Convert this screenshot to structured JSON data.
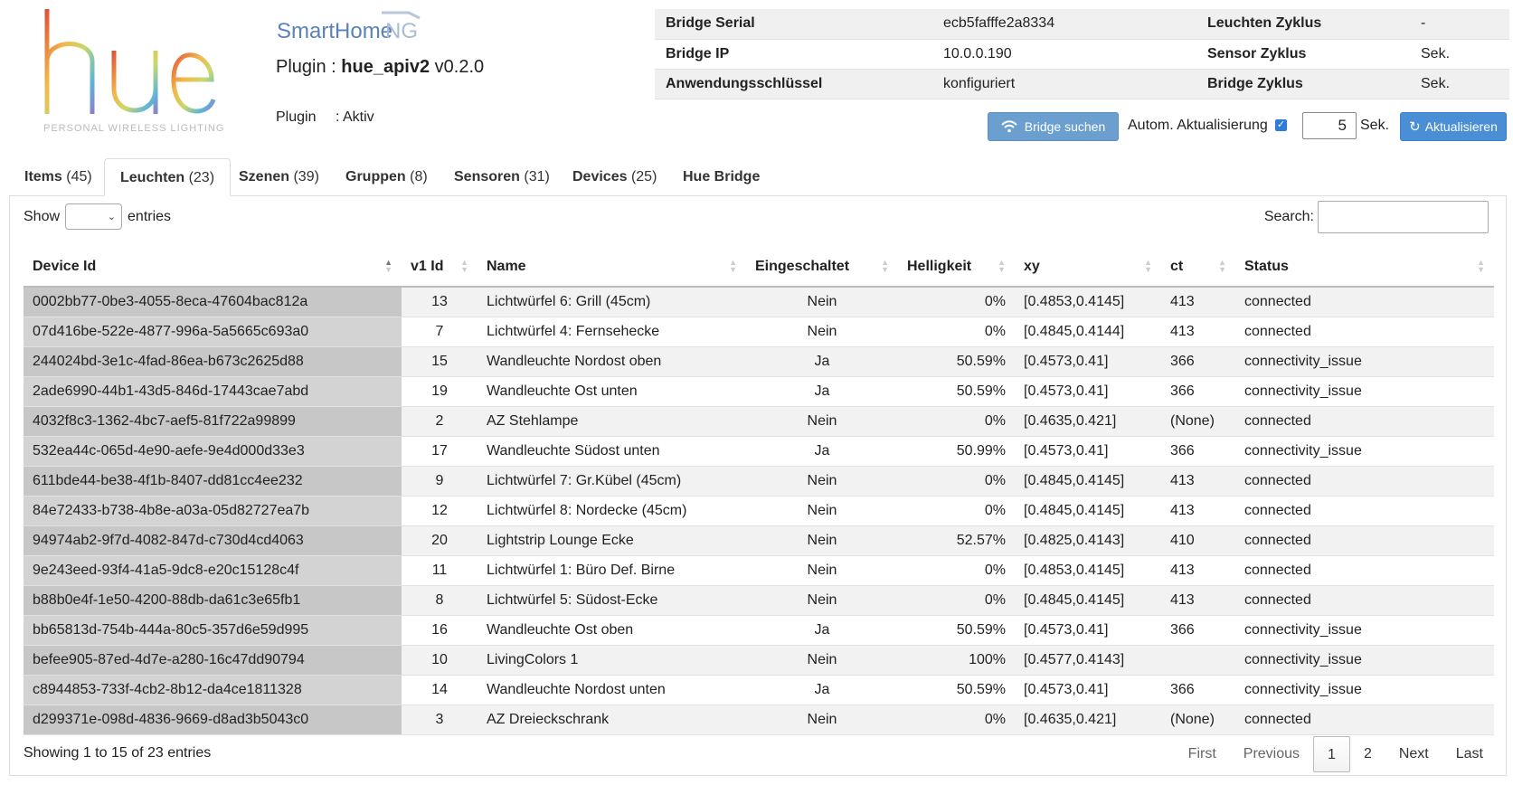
{
  "logo": {
    "name": "hue",
    "tagline": "PERSONAL WIRELESS LIGHTING"
  },
  "smarthome_logo": "SmartHomeNG",
  "plugin": {
    "title_prefix": "Plugin : ",
    "name": "hue_apiv2",
    "version": "v0.2.0",
    "status_label": "Plugin",
    "status_value": ": Aktiv"
  },
  "bridge_info": [
    {
      "k1": "Bridge Serial",
      "v1": "ecb5fafffe2a8334",
      "k2": "Leuchten Zyklus",
      "v2": "-"
    },
    {
      "k1": "Bridge IP",
      "v1": "10.0.0.190",
      "k2": "Sensor Zyklus",
      "v2": "Sek."
    },
    {
      "k1": "Anwendungsschlüssel",
      "v1": "konfiguriert",
      "k2": "Bridge Zyklus",
      "v2": "Sek."
    }
  ],
  "controls": {
    "bridge_search_label": "Bridge suchen",
    "auto_update_label": "Autom. Aktualisierung",
    "auto_update_checked": true,
    "interval_value": "5",
    "interval_unit": "Sek.",
    "refresh_label": "Aktualisieren",
    "accent": "#4a8fd6"
  },
  "tabs": [
    {
      "label": "Items",
      "count": "(45)",
      "active": false
    },
    {
      "label": "Leuchten",
      "count": "(23)",
      "active": true
    },
    {
      "label": "Szenen",
      "count": "(39)",
      "active": false
    },
    {
      "label": "Gruppen",
      "count": "(8)",
      "active": false
    },
    {
      "label": "Sensoren",
      "count": "(31)",
      "active": false
    },
    {
      "label": "Devices",
      "count": "(25)",
      "active": false
    },
    {
      "label": "Hue Bridge",
      "count": "",
      "active": false
    }
  ],
  "table_controls": {
    "show_label": "Show",
    "entries_label": "entries",
    "search_label": "Search:",
    "search_value": ""
  },
  "columns": [
    "Device Id",
    "v1 Id",
    "Name",
    "Eingeschaltet",
    "Helligkeit",
    "xy",
    "ct",
    "Status"
  ],
  "rows": [
    [
      "0002bb77-0be3-4055-8eca-47604bac812a",
      "13",
      "Lichtwürfel 6: Grill (45cm)",
      "Nein",
      "0%",
      "[0.4853,0.4145]",
      "413",
      "connected"
    ],
    [
      "07d416be-522e-4877-996a-5a5665c693a0",
      "7",
      "Lichtwürfel 4: Fernsehecke",
      "Nein",
      "0%",
      "[0.4845,0.4144]",
      "413",
      "connected"
    ],
    [
      "244024bd-3e1c-4fad-86ea-b673c2625d88",
      "15",
      "Wandleuchte Nordost oben",
      "Ja",
      "50.59%",
      "[0.4573,0.41]",
      "366",
      "connectivity_issue"
    ],
    [
      "2ade6990-44b1-43d5-846d-17443cae7abd",
      "19",
      "Wandleuchte Ost unten",
      "Ja",
      "50.59%",
      "[0.4573,0.41]",
      "366",
      "connectivity_issue"
    ],
    [
      "4032f8c3-1362-4bc7-aef5-81f722a99899",
      "2",
      "AZ Stehlampe",
      "Nein",
      "0%",
      "[0.4635,0.421]",
      "(None)",
      "connected"
    ],
    [
      "532ea44c-065d-4e90-aefe-9e4d000d33e3",
      "17",
      "Wandleuchte Südost unten",
      "Ja",
      "50.99%",
      "[0.4573,0.41]",
      "366",
      "connectivity_issue"
    ],
    [
      "611bde44-be38-4f1b-8407-dd81cc4ee232",
      "9",
      "Lichtwürfel 7: Gr.Kübel (45cm)",
      "Nein",
      "0%",
      "[0.4845,0.4145]",
      "413",
      "connected"
    ],
    [
      "84e72433-b738-4b8e-a03a-05d82727ea7b",
      "12",
      "Lichtwürfel 8: Nordecke (45cm)",
      "Nein",
      "0%",
      "[0.4845,0.4145]",
      "413",
      "connected"
    ],
    [
      "94974ab2-9f7d-4082-847d-c730d4cd4063",
      "20",
      "Lightstrip Lounge Ecke",
      "Nein",
      "52.57%",
      "[0.4825,0.4143]",
      "410",
      "connected"
    ],
    [
      "9e243eed-93f4-41a5-9dc8-e20c15128c4f",
      "11",
      "Lichtwürfel 1: Büro Def. Birne",
      "Nein",
      "0%",
      "[0.4853,0.4145]",
      "413",
      "connected"
    ],
    [
      "b88b0e4f-1e50-4200-88db-da61c3e65fb1",
      "8",
      "Lichtwürfel 5: Südost-Ecke",
      "Nein",
      "0%",
      "[0.4845,0.4145]",
      "413",
      "connected"
    ],
    [
      "bb65813d-754b-444a-80c5-357d6e59d995",
      "16",
      "Wandleuchte Ost oben",
      "Ja",
      "50.59%",
      "[0.4573,0.41]",
      "366",
      "connectivity_issue"
    ],
    [
      "befee905-87ed-4d7e-a280-16c47dd90794",
      "10",
      "LivingColors 1",
      "Nein",
      "100%",
      "[0.4577,0.4143]",
      "",
      "connectivity_issue"
    ],
    [
      "c8944853-733f-4cb2-8b12-da4ce1811328",
      "14",
      "Wandleuchte Nordost unten",
      "Ja",
      "50.59%",
      "[0.4573,0.41]",
      "366",
      "connectivity_issue"
    ],
    [
      "d299371e-098d-4836-9669-d8ad3b5043c0",
      "3",
      "AZ Dreieckschrank",
      "Nein",
      "0%",
      "[0.4635,0.421]",
      "(None)",
      "connected"
    ]
  ],
  "footer": {
    "info": "Showing 1 to 15 of 23 entries",
    "first": "First",
    "previous": "Previous",
    "pages": [
      "1",
      "2"
    ],
    "current_page": "1",
    "next": "Next",
    "last": "Last"
  }
}
